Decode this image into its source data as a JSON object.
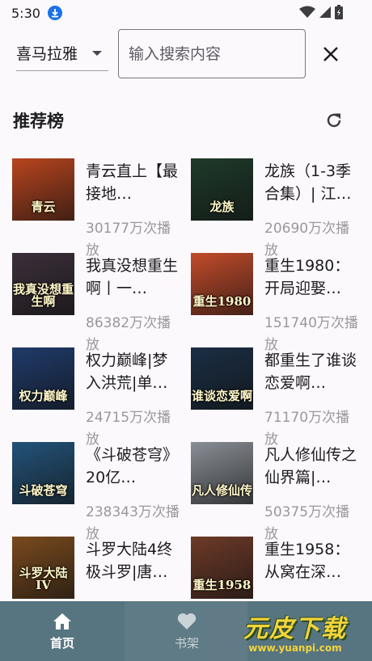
{
  "status_bar": {
    "time": "5:30"
  },
  "search": {
    "source": "喜马拉雅",
    "placeholder": "输入搜索内容",
    "value": ""
  },
  "section": {
    "title": "推荐榜"
  },
  "books": [
    {
      "title": "青云直上【最接地…",
      "plays": "30177万次播放",
      "cover_text": "青云",
      "cover_bg": "#b8451e"
    },
    {
      "title": "龙族（1-3季合集）| 江…",
      "plays": "20690万次播放",
      "cover_text": "龙族",
      "cover_bg": "#1e3a2a"
    },
    {
      "title": "我真没想重生啊丨一…",
      "plays": "86382万次播放",
      "cover_text": "我真没想重生啊",
      "cover_bg": "#3b2f3a"
    },
    {
      "title": "重生1980：开局迎娶…",
      "plays": "151740万次播放",
      "cover_text": "重生1980",
      "cover_bg": "#c24b2a"
    },
    {
      "title": "权力巅峰|梦入洪荒|单…",
      "plays": "24715万次播放",
      "cover_text": "权力巅峰",
      "cover_bg": "#1f3b6a"
    },
    {
      "title": "都重生了谁谈恋爱啊…",
      "plays": "71170万次播放",
      "cover_text": "谁谈恋爱啊",
      "cover_bg": "#1a2e44"
    },
    {
      "title": "《斗破苍穹》20亿…",
      "plays": "238343万次播放",
      "cover_text": "斗破苍穹",
      "cover_bg": "#23537a"
    },
    {
      "title": "凡人修仙传之仙界篇|…",
      "plays": "50375万次播放",
      "cover_text": "凡人修仙传",
      "cover_bg": "#8a8f96"
    },
    {
      "title": "斗罗大陆4终极斗罗|唐…",
      "plays": "",
      "cover_text": "斗罗大陆IV",
      "cover_bg": "#7a4a1e"
    },
    {
      "title": "重生1958：从窝在深…",
      "plays": "",
      "cover_text": "重生1958",
      "cover_bg": "#6d3a28"
    }
  ],
  "nav": {
    "home_label": "首页",
    "shelf_label": "书架"
  },
  "watermark": {
    "title": "元皮下载",
    "url": "www.yuanpi.com"
  }
}
